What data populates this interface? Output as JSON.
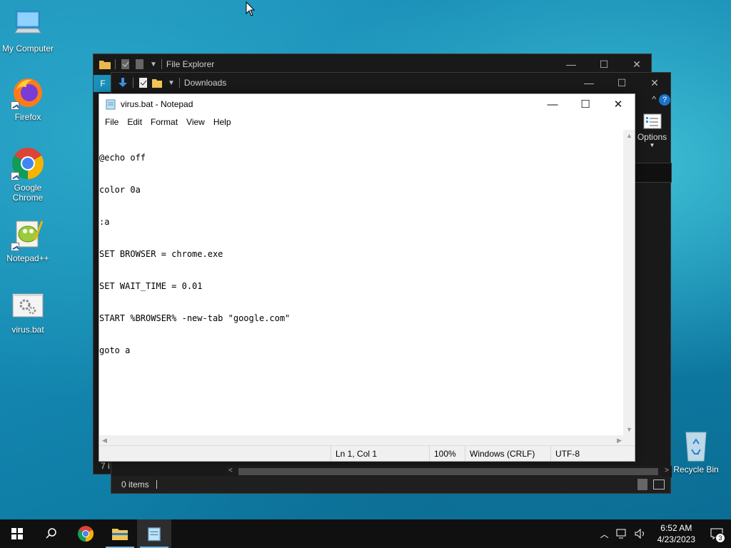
{
  "desktop": {
    "icons": [
      {
        "label": "My Computer"
      },
      {
        "label": "Firefox"
      },
      {
        "label": "Google Chrome"
      },
      {
        "label": "Notepad++"
      },
      {
        "label": "virus.bat"
      }
    ],
    "recycle_bin": "Recycle Bin"
  },
  "file_explorer": {
    "title": "File Explorer",
    "status_items": "7 i"
  },
  "downloads": {
    "title": "Downloads",
    "options_label": "Options",
    "status_items": "0 items",
    "tab_letter": "F"
  },
  "notepad": {
    "title": "virus.bat - Notepad",
    "menu": [
      "File",
      "Edit",
      "Format",
      "View",
      "Help"
    ],
    "lines": [
      "@echo off",
      "color 0a",
      ":a",
      "SET BROWSER = chrome.exe",
      "SET WAIT_TIME = 0.01",
      "START %BROWSER% -new-tab \"google.com\"",
      "goto a"
    ],
    "status": {
      "position": "Ln 1, Col 1",
      "zoom": "100%",
      "line_ending": "Windows (CRLF)",
      "encoding": "UTF-8"
    }
  },
  "taskbar": {
    "time": "6:52 AM",
    "date": "4/23/2023",
    "notification_count": "3"
  },
  "colors": {
    "accent": "#76b9ed",
    "taskbar": "#101010",
    "explorer_dark": "#191919"
  }
}
